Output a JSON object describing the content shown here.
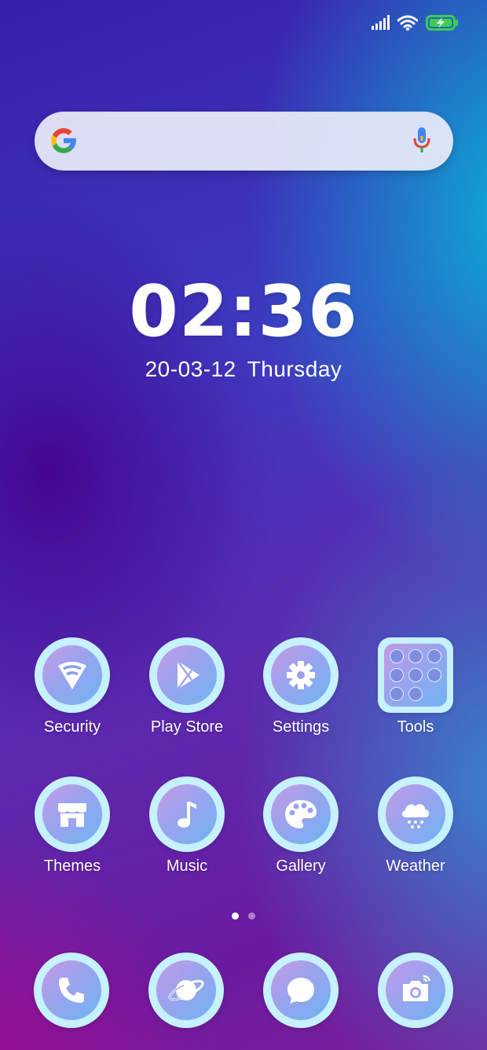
{
  "status_bar": {
    "icons": [
      "signal-icon",
      "wifi-icon",
      "battery-charging-icon"
    ],
    "battery_color": "#3ccf4e"
  },
  "search": {
    "logo": "google-g-icon",
    "mic": "microphone-icon"
  },
  "clock": {
    "time": "02:36",
    "date": "20-03-12",
    "weekday": "Thursday"
  },
  "apps_row1": [
    {
      "label": "Security",
      "icon": "shield-icon"
    },
    {
      "label": "Play Store",
      "icon": "play-store-icon"
    },
    {
      "label": "Settings",
      "icon": "gear-icon"
    },
    {
      "label": "Tools",
      "icon": "folder-icon"
    }
  ],
  "apps_row2": [
    {
      "label": "Themes",
      "icon": "store-icon"
    },
    {
      "label": "Music",
      "icon": "music-note-icon"
    },
    {
      "label": "Gallery",
      "icon": "palette-icon"
    },
    {
      "label": "Weather",
      "icon": "cloud-snow-icon"
    }
  ],
  "page_indicator": {
    "pages": 2,
    "current": 1
  },
  "dock": [
    {
      "icon": "phone-icon"
    },
    {
      "icon": "browser-planet-icon"
    },
    {
      "icon": "message-icon"
    },
    {
      "icon": "camera-icon"
    }
  ],
  "colors": {
    "icon_ring": "#c6f1ff",
    "icon_fill_start": "#c59ae6",
    "icon_fill_end": "#6fb4f2"
  }
}
